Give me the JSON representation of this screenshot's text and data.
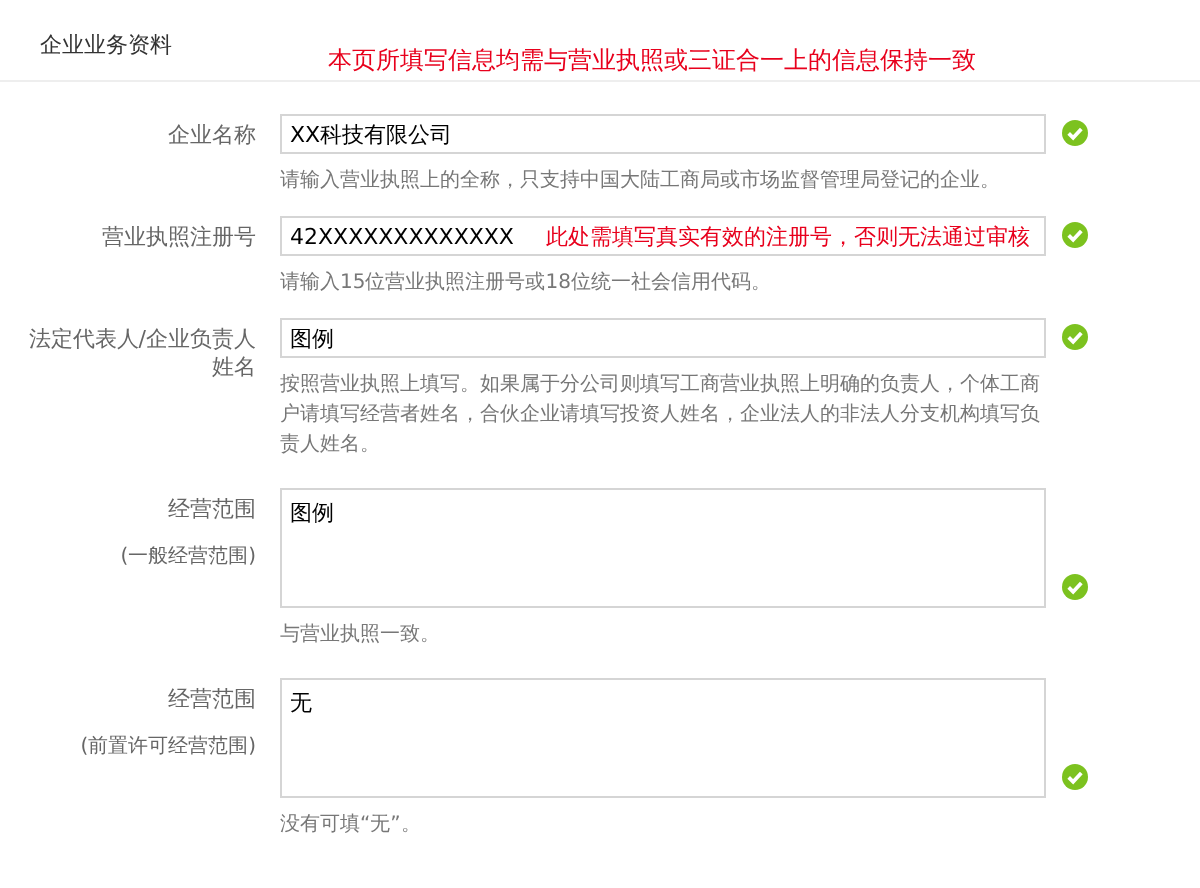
{
  "section_title": "企业业务资料",
  "notice": "本页所填写信息均需与营业执照或三证合一上的信息保持一致",
  "fields": [
    {
      "kind": "input",
      "label": "企业名称",
      "value": "XX科技有限公司",
      "valid": true,
      "hint": "请输入营业执照上的全称，只支持中国大陆工商局或市场监督管理局登记的企业。"
    },
    {
      "kind": "input",
      "label": "营业执照注册号",
      "value": "42XXXXXXXXXXXXX",
      "annotation": "此处需填写真实有效的注册号，否则无法通过审核",
      "valid": true,
      "hint": "请输入15位营业执照注册号或18位统一社会信用代码。"
    },
    {
      "kind": "input",
      "label": "法定代表人/企业负责人姓名",
      "value": "图例",
      "valid": true,
      "hint": "按照营业执照上填写。如果属于分公司则填写工商营业执照上明确的负责人，个体工商户请填写经营者姓名，合伙企业请填写投资人姓名，企业法人的非法人分支机构填写负责人姓名。"
    },
    {
      "kind": "textarea",
      "label": "经营范围",
      "sublabel": "(一般经营范围)",
      "value": "图例",
      "valid": true,
      "hint": "与营业执照一致。"
    },
    {
      "kind": "textarea",
      "label": "经营范围",
      "sublabel": "(前置许可经营范围)",
      "value": "无",
      "valid": true,
      "hint": "没有可填“无”。"
    }
  ]
}
